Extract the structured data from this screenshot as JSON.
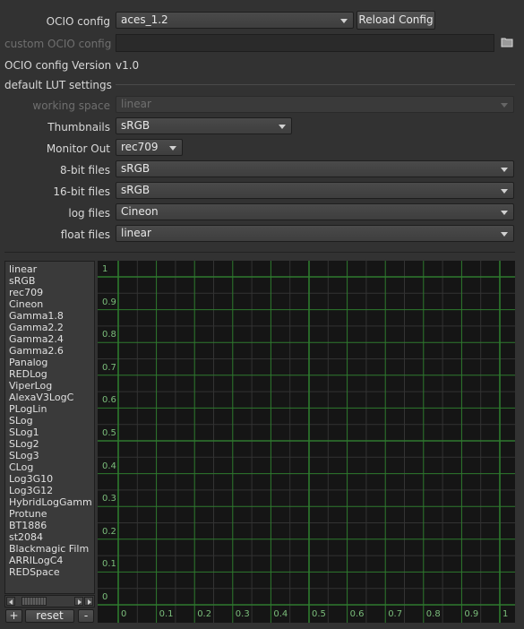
{
  "ocio": {
    "config_label": "OCIO config",
    "config_value": "aces_1.2",
    "reload_button": "Reload Config",
    "custom_label": "custom OCIO config",
    "custom_value": "",
    "version_label": "OCIO config Version",
    "version_value": "v1.0"
  },
  "lut": {
    "section_label": "default LUT settings",
    "rows": [
      {
        "label": "working space",
        "value": "linear",
        "disabled": true
      },
      {
        "label": "Thumbnails",
        "value": "sRGB"
      },
      {
        "label": "Monitor Out",
        "value": "rec709"
      },
      {
        "label": "8-bit files",
        "value": "sRGB"
      },
      {
        "label": "16-bit files",
        "value": "sRGB"
      },
      {
        "label": "log files",
        "value": "Cineon"
      },
      {
        "label": "float files",
        "value": "linear"
      }
    ]
  },
  "lut_list": [
    "linear",
    "sRGB",
    "rec709",
    "Cineon",
    "Gamma1.8",
    "Gamma2.2",
    "Gamma2.4",
    "Gamma2.6",
    "Panalog",
    "REDLog",
    "ViperLog",
    "AlexaV3LogC",
    "PLogLin",
    "SLog",
    "SLog1",
    "SLog2",
    "SLog3",
    "CLog",
    "Log3G10",
    "Log3G12",
    "HybridLogGamm",
    "Protune",
    "BT1886",
    "st2084",
    "Blackmagic Film",
    "ARRILogC4",
    "REDSpace"
  ],
  "list_buttons": {
    "add": "+",
    "reset": "reset",
    "remove": "-"
  },
  "graph": {
    "y_ticks": [
      "1",
      "0.9",
      "0.8",
      "0.7",
      "0.6",
      "0.5",
      "0.4",
      "0.3",
      "0.2",
      "0.1",
      "0"
    ],
    "x_ticks": [
      "0",
      "0.1",
      "0.2",
      "0.3",
      "0.4",
      "0.5",
      "0.6",
      "0.7",
      "0.8",
      "0.9",
      "1"
    ],
    "grid_color": "#2e7a2e",
    "minor_color": "#333333",
    "background": "#151515"
  }
}
